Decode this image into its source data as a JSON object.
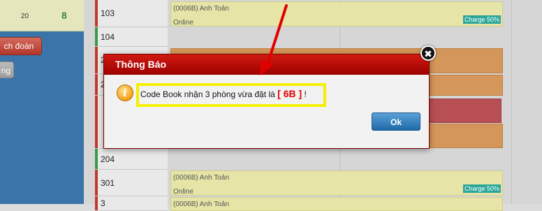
{
  "left_panel": {
    "count_small": "20",
    "count_big": "8",
    "button_doan": "ch đoàn",
    "button_ng": "ng"
  },
  "rooms": [
    {
      "number": "103"
    },
    {
      "number": "104"
    },
    {
      "number": "2"
    },
    {
      "number": "2"
    },
    {
      "number": "204"
    },
    {
      "number": "301"
    },
    {
      "number": "3"
    }
  ],
  "bookings": [
    {
      "guest": "(0006B) Anh Toản",
      "status": "Online",
      "charge": "Charge 50%"
    },
    {
      "guest": "(0006B) Anh Toản",
      "status": "Online",
      "charge": "Charge 50%"
    },
    {
      "guest": "(0006B) Anh Toản"
    }
  ],
  "dialog": {
    "title": "Thông Báo",
    "message_prefix": "Code Book nhận 3 phòng vừa đặt là",
    "code": "[ 6B ]",
    "message_suffix": "!",
    "ok_label": "Ok",
    "close_glyph": "✖"
  },
  "colors": {
    "dialog_header": "#c00000",
    "highlight_border": "#f4f000",
    "arrow": "#e00000",
    "code_text": "#e00000"
  }
}
